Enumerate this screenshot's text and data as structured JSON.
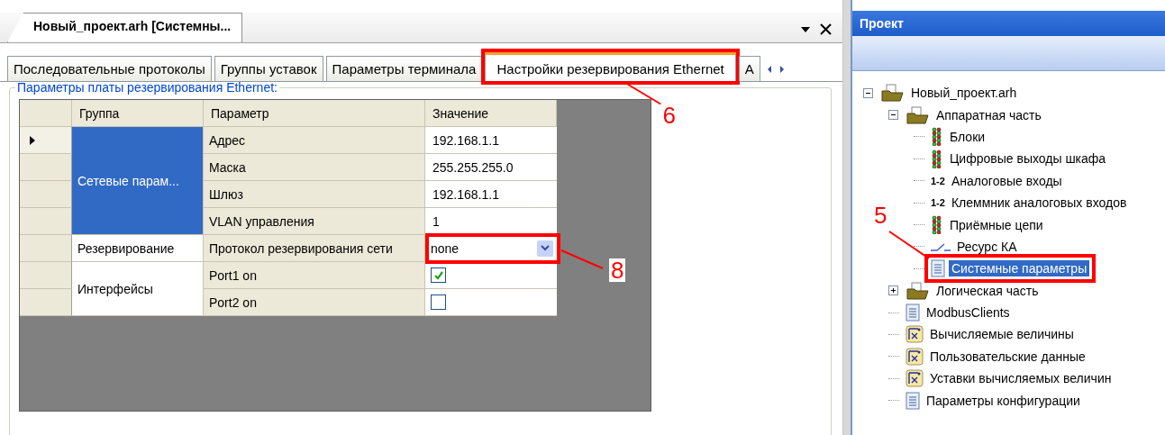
{
  "document_tab": {
    "title": "Новый_проект.arh [Системны..."
  },
  "tabs": [
    {
      "label": "Последовательные протоколы",
      "selected": false
    },
    {
      "label": "Группы уставок",
      "selected": false
    },
    {
      "label": "Параметры терминала",
      "selected": false
    },
    {
      "label": "Настройки резервирования Ethernet",
      "selected": true,
      "callout": "6"
    },
    {
      "label": "А",
      "selected": false
    }
  ],
  "group_box": {
    "title": "Параметры платы резервирования Ethernet:"
  },
  "table": {
    "columns": [
      "Группа",
      "Параметр",
      "Значение"
    ],
    "groups": [
      {
        "name": "Сетевые парам...",
        "selected": true,
        "rows": [
          {
            "parameter": "Адрес",
            "kind": "text",
            "value": "192.168.1.1",
            "current": true
          },
          {
            "parameter": "Маска",
            "kind": "text",
            "value": "255.255.255.0",
            "current": false
          },
          {
            "parameter": "Шлюз",
            "kind": "text",
            "value": "192.168.1.1",
            "current": false
          },
          {
            "parameter": "VLAN управления",
            "kind": "text",
            "value": "1",
            "current": false
          }
        ]
      },
      {
        "name": "Резервирование",
        "selected": false,
        "rows": [
          {
            "parameter": "Протокол резервирования сети",
            "kind": "dropdown",
            "value": "none",
            "current": false,
            "callout": "8"
          }
        ]
      },
      {
        "name": "Интерфейсы",
        "selected": false,
        "rows": [
          {
            "parameter": "Port1 on",
            "kind": "checkbox",
            "checked": true,
            "current": false
          },
          {
            "parameter": "Port2 on",
            "kind": "checkbox",
            "checked": false,
            "current": false
          }
        ]
      }
    ]
  },
  "project_panel": {
    "title": "Проект",
    "tree": [
      {
        "label": "Новый_проект.arh",
        "kind": "folder",
        "expanded": true,
        "selected": false,
        "children": [
          {
            "label": "Аппаратная часть",
            "kind": "folder",
            "expanded": true,
            "selected": false,
            "children": [
              {
                "label": "Блоки",
                "kind": "leds",
                "selected": false
              },
              {
                "label": "Цифровые выходы шкафа",
                "kind": "leds",
                "selected": false
              },
              {
                "label": "Аналоговые входы",
                "kind": "numeric",
                "icon_text": "1-2",
                "selected": false
              },
              {
                "label": "Клеммник аналоговых входов",
                "kind": "numeric",
                "icon_text": "1-2",
                "selected": false
              },
              {
                "label": "Приёмные цепи",
                "kind": "leds",
                "selected": false
              },
              {
                "label": "Ресурс КА",
                "kind": "switch",
                "selected": false
              },
              {
                "label": "Системные параметры",
                "kind": "document",
                "selected": true,
                "callout": "5"
              }
            ]
          },
          {
            "label": "Логическая часть",
            "kind": "folder",
            "expanded": false,
            "selected": false
          },
          {
            "label": "ModbusClients",
            "kind": "document",
            "selected": false
          },
          {
            "label": "Вычисляемые величины",
            "kind": "calc",
            "selected": false
          },
          {
            "label": "Пользовательские данные",
            "kind": "calc",
            "selected": false
          },
          {
            "label": "Уставки вычисляемых величин",
            "kind": "calc",
            "selected": false
          },
          {
            "label": "Параметры конфигурации",
            "kind": "document",
            "selected": false
          }
        ]
      }
    ]
  }
}
